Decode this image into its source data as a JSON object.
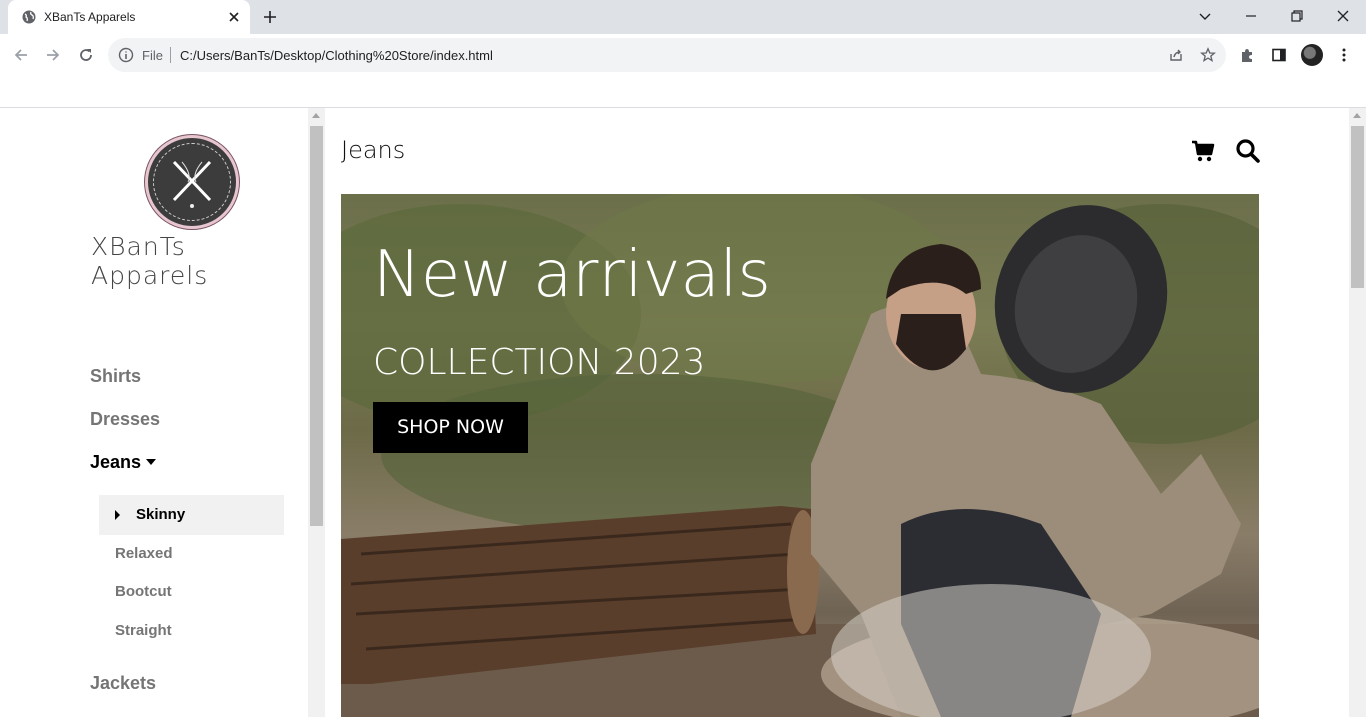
{
  "browser": {
    "tab_title": "XBanTs Apparels",
    "scheme_label": "File",
    "url": "C:/Users/BanTs/Desktop/Clothing%20Store/index.html",
    "icons": [
      "globe-icon",
      "close-icon",
      "plus-icon",
      "chevron-down-icon",
      "minimize-icon",
      "restore-icon",
      "close-window-icon",
      "back-arrow-icon",
      "forward-arrow-icon",
      "reload-icon",
      "info-icon",
      "share-icon",
      "star-icon",
      "puzzle-icon",
      "side-panel-icon",
      "kebab-menu-icon"
    ]
  },
  "sidebar": {
    "brand": "XBanTs Apparels",
    "categories": [
      {
        "label": "Shirts"
      },
      {
        "label": "Dresses"
      },
      {
        "label": "Jeans",
        "expanded": true
      },
      {
        "label": "Jackets"
      }
    ],
    "jeans_items": [
      {
        "label": "Skinny",
        "selected": true
      },
      {
        "label": "Relaxed"
      },
      {
        "label": "Bootcut"
      },
      {
        "label": "Straight"
      }
    ]
  },
  "main": {
    "page_title": "Jeans",
    "hero": {
      "title": "New arrivals",
      "subtitle": "COLLECTION 2023",
      "button": "SHOP NOW"
    },
    "icons": [
      "cart-icon",
      "search-icon"
    ]
  }
}
